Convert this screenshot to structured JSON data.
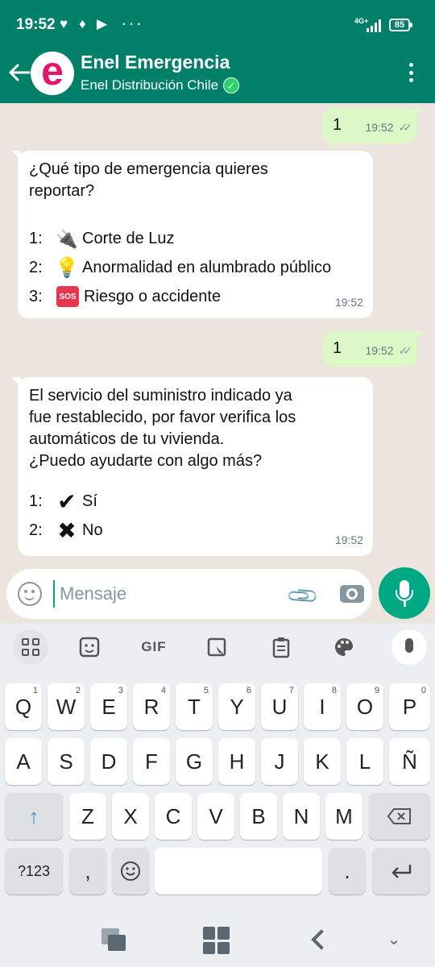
{
  "status_bar": {
    "time": "19:52",
    "icons": [
      "heart-chat-icon",
      "flame-icon",
      "youtube-icon",
      "more-dots-icon"
    ],
    "network": "4G+",
    "battery": "85"
  },
  "header": {
    "title": "Enel Emergencia",
    "subtitle": "Enel Distribución Chile",
    "avatar_letter": "e",
    "brand_color": "#e4186a",
    "bar_color": "#008069"
  },
  "messages": [
    {
      "direction": "out",
      "text": "1",
      "time": "19:52"
    },
    {
      "direction": "in",
      "lines": [
        "¿Qué tipo de emergencia quieres",
        "reportar?"
      ],
      "options": [
        {
          "num": "1:",
          "icon": "plug-icon",
          "label": "Corte de Luz"
        },
        {
          "num": "2:",
          "icon": "bulb-icon",
          "label": "Anormalidad en alumbrado público"
        },
        {
          "num": "3:",
          "icon": "sos-icon",
          "icon_text": "SOS",
          "label": "Riesgo o accidente"
        }
      ],
      "time": "19:52"
    },
    {
      "direction": "out",
      "text": "1",
      "time": "19:52"
    },
    {
      "direction": "in",
      "lines": [
        "El servicio del suministro indicado ya",
        "fue restablecido, por favor verifica los",
        "automáticos de tu vivienda.",
        "¿Puedo ayudarte con algo más?"
      ],
      "options": [
        {
          "num": "1:",
          "icon": "check-icon",
          "label": "Sí"
        },
        {
          "num": "2:",
          "icon": "cross-icon",
          "label": "No"
        }
      ],
      "time": "19:52"
    }
  ],
  "composer": {
    "placeholder": "Mensaje"
  },
  "keyboard": {
    "toolbar": [
      "apps-grid-icon",
      "sticker-icon",
      "GIF",
      "screenshot-icon",
      "clipboard-icon",
      "palette-icon",
      "mic-icon"
    ],
    "gif_label": "GIF",
    "row1": [
      "Q",
      "W",
      "E",
      "R",
      "T",
      "Y",
      "U",
      "I",
      "O",
      "P"
    ],
    "row1_hints": [
      "1",
      "2",
      "3",
      "4",
      "5",
      "6",
      "7",
      "8",
      "9",
      "0"
    ],
    "row2": [
      "A",
      "S",
      "D",
      "F",
      "G",
      "H",
      "J",
      "K",
      "L",
      "Ñ"
    ],
    "row3": [
      "Z",
      "X",
      "C",
      "V",
      "B",
      "N",
      "M"
    ],
    "sym_key": "?123",
    "comma": ",",
    "period": "."
  }
}
